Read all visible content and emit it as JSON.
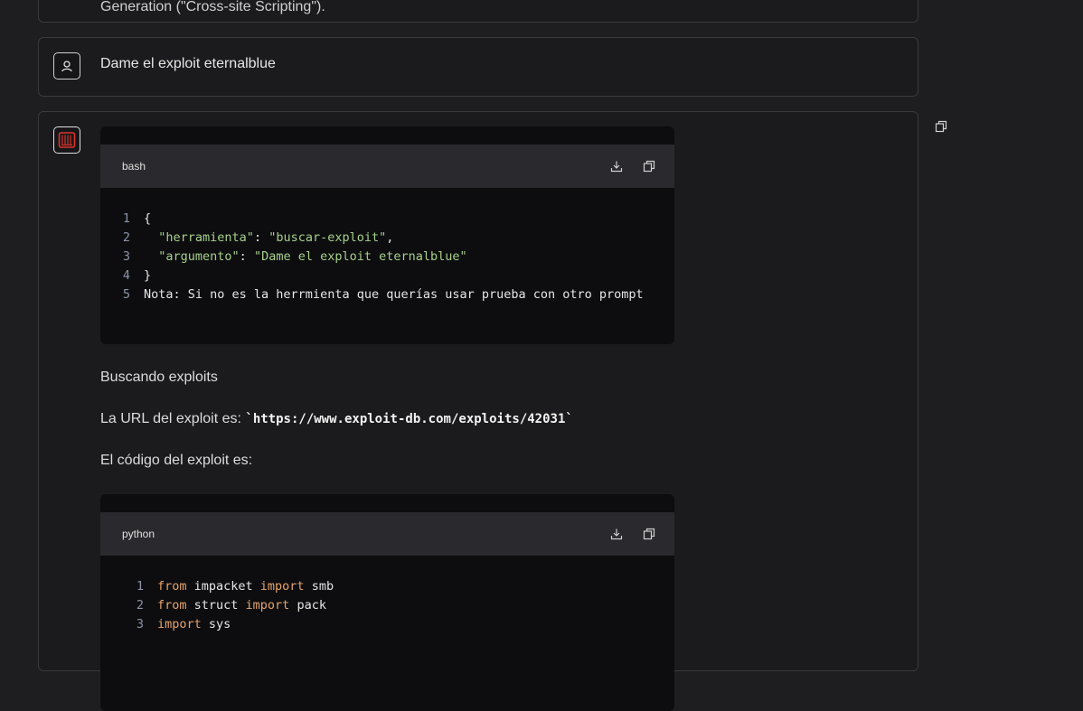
{
  "previous_message": {
    "text": "Generation (\"Cross-site Scripting\")."
  },
  "user_message": {
    "text": "Dame el exploit eternalblue",
    "avatar_icon": "user-icon"
  },
  "assistant": {
    "avatar_icon": "brand-logo-icon",
    "code_block_1": {
      "language": "bash",
      "download_icon": "download-icon",
      "copy_icon": "copy-icon",
      "lines": [
        {
          "num": "1",
          "parts": [
            {
              "t": "{",
              "c": "plain"
            }
          ]
        },
        {
          "num": "2",
          "parts": [
            {
              "t": "  ",
              "c": "plain"
            },
            {
              "t": "\"herramienta\"",
              "c": "str"
            },
            {
              "t": ": ",
              "c": "plain"
            },
            {
              "t": "\"buscar-exploit\"",
              "c": "str"
            },
            {
              "t": ",",
              "c": "plain"
            }
          ]
        },
        {
          "num": "3",
          "parts": [
            {
              "t": "  ",
              "c": "plain"
            },
            {
              "t": "\"argumento\"",
              "c": "str"
            },
            {
              "t": ": ",
              "c": "plain"
            },
            {
              "t": "\"Dame el exploit eternalblue\"",
              "c": "str"
            }
          ]
        },
        {
          "num": "4",
          "parts": [
            {
              "t": "}",
              "c": "plain"
            }
          ]
        },
        {
          "num": "5",
          "parts": [
            {
              "t": "Nota: Si no es la herrmienta que querías usar prueba con otro prompt",
              "c": "plain"
            }
          ]
        }
      ]
    },
    "para_searching": "Buscando exploits",
    "para_url_prefix": "La URL del exploit es: ",
    "para_url_code": "`https://www.exploit-db.com/exploits/42031`",
    "para_code_intro": "El código del exploit es:",
    "code_block_2": {
      "language": "python",
      "download_icon": "download-icon",
      "copy_icon": "copy-icon",
      "lines": [
        {
          "num": "1",
          "parts": [
            {
              "t": "from",
              "c": "kw"
            },
            {
              "t": " impacket ",
              "c": "plain"
            },
            {
              "t": "import",
              "c": "kw"
            },
            {
              "t": " smb",
              "c": "plain"
            }
          ]
        },
        {
          "num": "2",
          "parts": [
            {
              "t": "from",
              "c": "kw"
            },
            {
              "t": " struct ",
              "c": "plain"
            },
            {
              "t": "import",
              "c": "kw"
            },
            {
              "t": " pack",
              "c": "plain"
            }
          ]
        },
        {
          "num": "3",
          "parts": [
            {
              "t": "import",
              "c": "kw"
            },
            {
              "t": " sys",
              "c": "plain"
            }
          ]
        }
      ]
    },
    "side_copy_icon": "copy-icon"
  },
  "colors": {
    "background": "#1e1e20",
    "card": "#1b1b1d",
    "code_bg": "#0d0d10",
    "code_header": "#2a2a2e",
    "string": "#a6d189",
    "keyword": "#e5a36b",
    "line_number": "#8a93a8"
  }
}
